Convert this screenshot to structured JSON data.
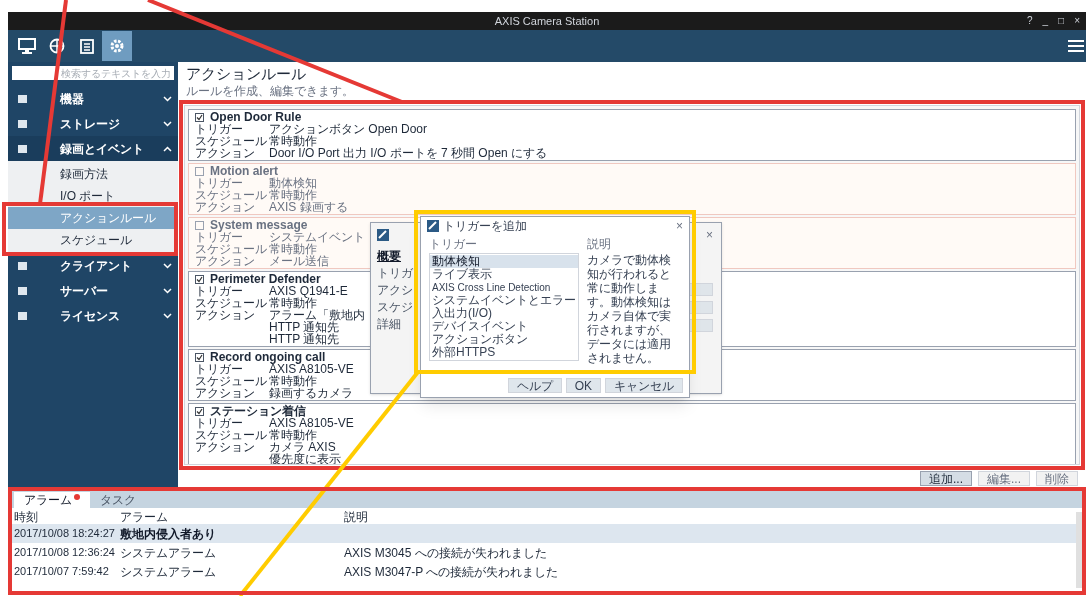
{
  "window": {
    "title": "AXIS Camera Station",
    "controls": [
      "?",
      "_",
      "□",
      "×"
    ]
  },
  "nav_tabs": [
    {
      "selected": false
    },
    {
      "selected": false
    },
    {
      "selected": false
    },
    {
      "selected": true
    }
  ],
  "sidebar": {
    "search": {
      "placeholder": "検索するテキストを入力"
    },
    "items": [
      {
        "label": "機器",
        "expanded": false
      },
      {
        "label": "ストレージ",
        "expanded": false
      },
      {
        "label": "録画とイベント",
        "expanded": true,
        "children": [
          {
            "label": "録画方法",
            "selected": false
          },
          {
            "label": "I/O ポート",
            "selected": false
          },
          {
            "label": "アクションルール",
            "selected": true
          },
          {
            "label": "スケジュール",
            "selected": false
          }
        ]
      },
      {
        "label": "クライアント",
        "expanded": false
      },
      {
        "label": "サーバー",
        "expanded": false
      },
      {
        "label": "ライセンス",
        "expanded": false
      }
    ]
  },
  "page": {
    "title": "アクションルール",
    "subtitle": "ルールを作成、編集できます。",
    "rules": [
      {
        "name": "Open Door Rule",
        "enabled": true,
        "fields": [
          {
            "label": "トリガー",
            "value": "アクションボタン Open Door"
          },
          {
            "label": "スケジュール",
            "value": "常時動作"
          },
          {
            "label": "アクション",
            "value": "Door I/O Port 出力 I/O ポートを 7 秒間 Open にする"
          }
        ]
      },
      {
        "name": "Motion alert",
        "enabled": false,
        "fields": [
          {
            "label": "トリガー",
            "value": "動体検知"
          },
          {
            "label": "スケジュール",
            "value": "常時動作"
          },
          {
            "label": "アクション",
            "value": "AXIS 録画する"
          }
        ]
      },
      {
        "name": "System message",
        "enabled": false,
        "fields": [
          {
            "label": "トリガー",
            "value": "システムイベント"
          },
          {
            "label": "スケジュール",
            "value": "常時動作"
          },
          {
            "label": "アクション",
            "value": "メール送信"
          }
        ]
      },
      {
        "name": "Perimeter Defender",
        "enabled": true,
        "fields": [
          {
            "label": "トリガー",
            "value": "AXIS Q1941-E"
          },
          {
            "label": "スケジュール",
            "value": "常時動作"
          },
          {
            "label": "アクション",
            "value": "アラーム「敷地内"
          },
          {
            "value": "HTTP 通知先"
          },
          {
            "value": "HTTP 通知先"
          }
        ]
      },
      {
        "name": "Record ongoing call",
        "enabled": true,
        "fields": [
          {
            "label": "トリガー",
            "value": "AXIS A8105-VE"
          },
          {
            "label": "スケジュール",
            "value": "常時動作"
          },
          {
            "label": "アクション",
            "value": "録画するカメラ"
          }
        ]
      },
      {
        "name": "ステーション着信",
        "enabled": true,
        "fields": [
          {
            "label": "トリガー",
            "value": "AXIS A8105-VE"
          },
          {
            "label": "スケジュール",
            "value": "常時動作"
          },
          {
            "label": "アクション",
            "value": "カメラ AXIS"
          },
          {
            "value": "優先度に表示"
          }
        ]
      }
    ],
    "buttons": [
      "追加...",
      "編集...",
      "削除"
    ]
  },
  "back_dialog": {
    "steps": [
      {
        "label": "概要",
        "selected": true
      },
      {
        "label": "トリガ",
        "selected": false
      },
      {
        "label": "アクシ",
        "selected": false
      },
      {
        "label": "スケジ",
        "selected": false
      },
      {
        "label": "詳細",
        "selected": false
      }
    ],
    "close": "×"
  },
  "trigger_dialog": {
    "title": "トリガーを追加",
    "close": "×",
    "list_label": "トリガー",
    "triggers": [
      {
        "label": "動体検知",
        "selected": true
      },
      {
        "label": "ライブ表示",
        "selected": false
      },
      {
        "label": "AXIS Cross Line Detection",
        "selected": false
      },
      {
        "label": "システムイベントとエラー",
        "selected": false
      },
      {
        "label": "入出力(I/O)",
        "selected": false
      },
      {
        "label": "デバイスイベント",
        "selected": false
      },
      {
        "label": "アクションボタン",
        "selected": false
      },
      {
        "label": "外部HTTPS",
        "selected": false
      }
    ],
    "description_label": "説明",
    "description": "カメラで動体検知が行われると常に動作します。動体検知はカメラ自体で実行されますが、データには適用されません。",
    "buttons": [
      "ヘルプ",
      "OK",
      "キャンセル"
    ]
  },
  "bottom_panel": {
    "tabs": [
      {
        "label": "アラーム",
        "selected": true,
        "badge": true
      },
      {
        "label": "タスク",
        "selected": false,
        "badge": false
      }
    ],
    "columns": [
      "時刻",
      "アラーム",
      "説明"
    ],
    "rows": [
      {
        "cells": [
          "2017/10/08 18:24:27",
          "敷地内侵入者あり"
        ],
        "selected": true
      },
      {
        "cells": [
          "2017/10/08 12:36:24",
          "システムアラーム",
          "AXIS M3045 への接続が失われました"
        ],
        "selected": false
      },
      {
        "cells": [
          "2017/10/07 7:59:42",
          "システムアラーム",
          "AXIS M3047-P への接続が失われました"
        ],
        "selected": false
      }
    ]
  },
  "annotations": [
    {
      "kind": "line",
      "color": "#e53935"
    },
    {
      "kind": "line",
      "color": "#e53935"
    },
    {
      "kind": "frame",
      "color": "#e53935"
    },
    {
      "kind": "frame",
      "color": "#e53935"
    },
    {
      "kind": "frame",
      "color": "#ffcc00"
    },
    {
      "kind": "line",
      "color": "#ffcc00"
    },
    {
      "kind": "frame",
      "color": "#e53935"
    }
  ]
}
